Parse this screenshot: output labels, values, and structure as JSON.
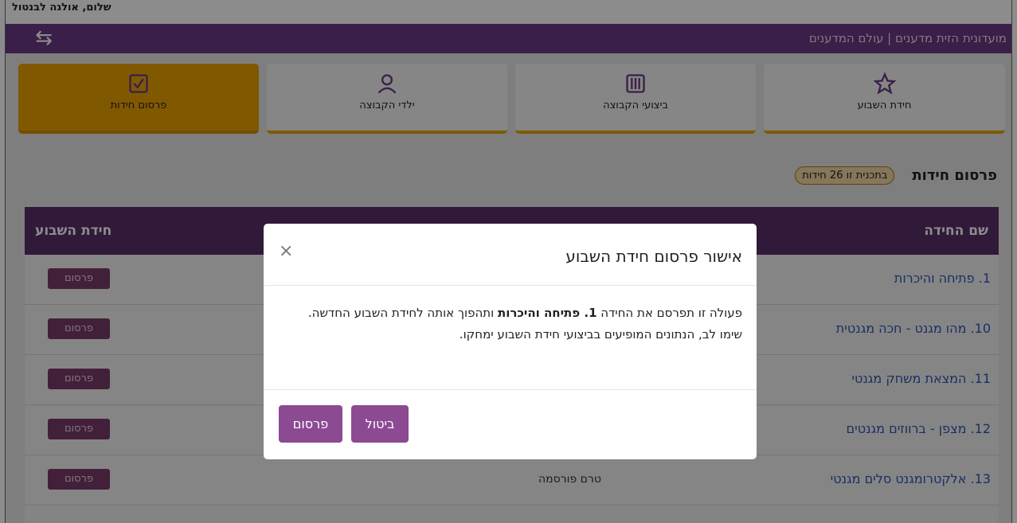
{
  "greeting": "שלום, אולגה לבנטול",
  "header": {
    "brand": "מועדונית הזית מדענים | עולם המדענים",
    "swap_icon": "swap-arrows-icon"
  },
  "tiles": [
    {
      "label": "חידת השבוע",
      "icon": "star-icon"
    },
    {
      "label": "ביצועי הקבוצה",
      "icon": "sliders-icon"
    },
    {
      "label": "ילדי הקבוצה",
      "icon": "user-icon"
    },
    {
      "label": "פרסום חידות",
      "icon": "checkbox-icon",
      "active": true
    }
  ],
  "page": {
    "title": "פרסום חידות",
    "badge": "בתכנית זו 26 חידות"
  },
  "table": {
    "col_name": "שם החידה",
    "col_week": "חידת השבוע",
    "rows": [
      {
        "name": "1. פתיחה והיכרות",
        "status": "",
        "action": "פרסום"
      },
      {
        "name": "10. מהו מגנט - חכה מגנטית",
        "status": "",
        "action": "פרסום"
      },
      {
        "name": "11. המצאת משחק מגנטי",
        "status": "",
        "action": "פרסום"
      },
      {
        "name": "12. מצפן - ברווזים מגנטים",
        "status": "",
        "action": "פרסום"
      },
      {
        "name": "13. אלקטרומגנט סלים מגנטי",
        "status": "טרם פורסמה",
        "action": "פרסום"
      }
    ]
  },
  "modal": {
    "title": "אישור פרסום חידת השבוע",
    "close": "×",
    "line1_pre": "פעולה זו תפרסם את החידה ",
    "line1_bold": "1. פתיחה והיכרות",
    "line1_post": " ותהפוך אותה לחידת השבוע החדשה.",
    "line2": "שימו לב, הנתונים המופיעים בביצועי חידת השבוע ימחקו.",
    "cancel": "ביטול",
    "publish": "פרסום"
  },
  "colors": {
    "purple": "#6b3a83",
    "accent": "#e9a000",
    "link": "#2d58b3"
  }
}
